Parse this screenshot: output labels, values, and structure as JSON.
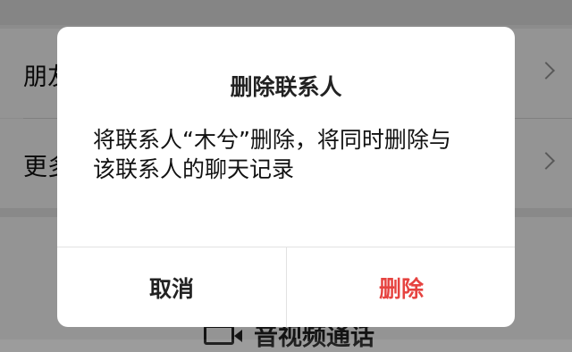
{
  "background": {
    "rows": [
      {
        "label": "朋友"
      },
      {
        "label": "更多"
      }
    ],
    "call_label": "音视频通话"
  },
  "dialog": {
    "title": "删除联系人",
    "message_line1": "将联系人“木兮”删除，将同时删除与",
    "message_line2": "该联系人的聊天记录",
    "cancel_label": "取消",
    "delete_label": "删除"
  },
  "colors": {
    "danger": "#e64340",
    "overlay": "rgba(0,0,0,0.42)"
  }
}
